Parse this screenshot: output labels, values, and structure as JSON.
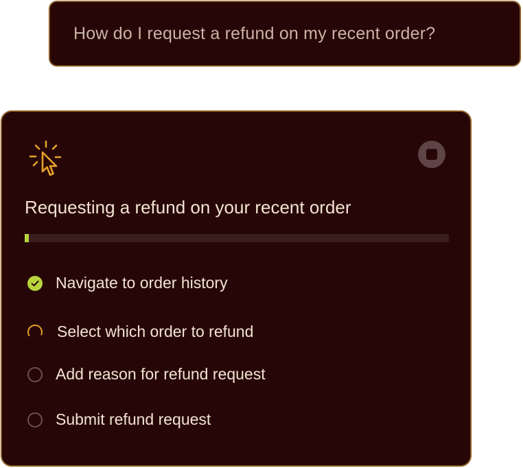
{
  "user_message": {
    "text": "How do I request a refund on my recent order?"
  },
  "task": {
    "icon": "cursor-click-icon",
    "stop_icon": "stop-icon",
    "title": "Requesting a refund on your recent order",
    "progress": 0.01,
    "steps": [
      {
        "label": "Navigate to order history",
        "status": "done"
      },
      {
        "label": "Select which order to refund",
        "status": "in-progress"
      },
      {
        "label": "Add reason for refund request",
        "status": "pending"
      },
      {
        "label": "Submit refund request",
        "status": "pending"
      }
    ]
  },
  "colors": {
    "background": "#260606",
    "border": "#8a5a22",
    "accent_green": "#b7d43f",
    "accent_orange": "#e8a22a",
    "text": "#f2e3d3"
  }
}
